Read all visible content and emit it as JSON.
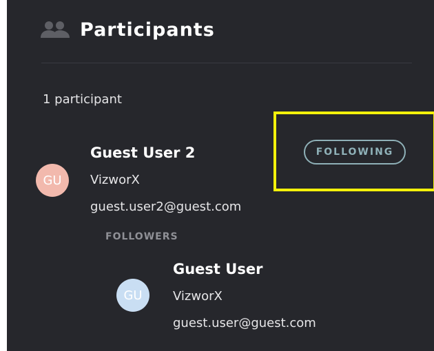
{
  "header": {
    "title": "Participants",
    "icon": "people-icon"
  },
  "participant_count": "1 participant",
  "participants": [
    {
      "initials": "GU",
      "name": "Guest User 2",
      "org": "VizworX",
      "email": "guest.user2@guest.com",
      "avatar_color": "#f2b9ad",
      "follow_button": "FOLLOWING",
      "followers_label": "FOLLOWERS",
      "followers": [
        {
          "initials": "GU",
          "name": "Guest User",
          "org": "VizworX",
          "email": "guest.user@guest.com",
          "avatar_color": "#c9def3"
        }
      ]
    }
  ],
  "colors": {
    "panel_bg": "#26272c",
    "button_accent": "#8fb1b8",
    "highlight": "#f3f10b"
  }
}
